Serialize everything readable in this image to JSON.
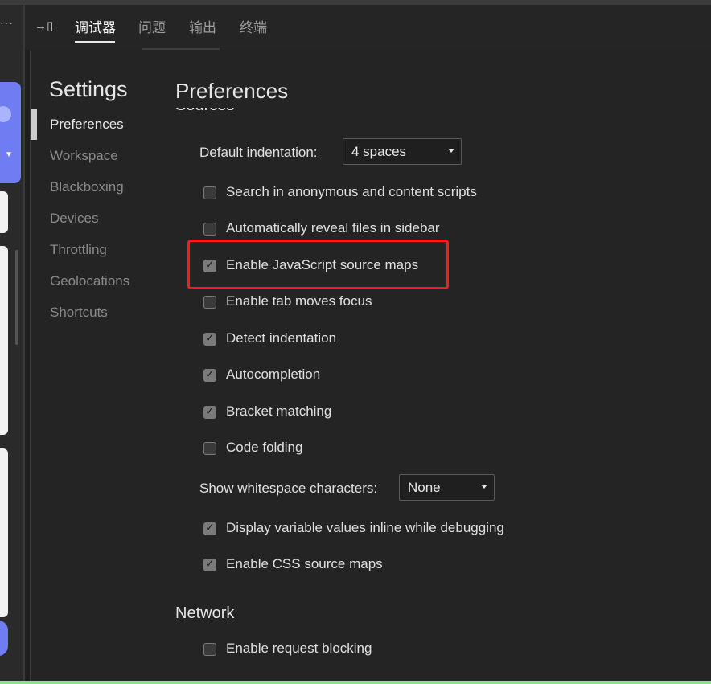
{
  "tabbar": {
    "dock_icon": "→▯",
    "tabs": [
      {
        "label": "调试器",
        "active": true
      },
      {
        "label": "问题",
        "active": false
      },
      {
        "label": "输出",
        "active": false
      },
      {
        "label": "终端",
        "active": false
      }
    ]
  },
  "settings": {
    "title": "Settings",
    "nav": [
      {
        "label": "Preferences",
        "active": true
      },
      {
        "label": "Workspace"
      },
      {
        "label": "Blackboxing"
      },
      {
        "label": "Devices"
      },
      {
        "label": "Throttling"
      },
      {
        "label": "Geolocations"
      },
      {
        "label": "Shortcuts"
      }
    ]
  },
  "preferences": {
    "title": "Preferences",
    "sources_heading": "Sources",
    "default_indentation_label": "Default indentation:",
    "default_indentation_value": "4 spaces",
    "checkboxes_top": [
      {
        "label": "Search in anonymous and content scripts",
        "checked": false
      },
      {
        "label": "Automatically reveal files in sidebar",
        "checked": false
      },
      {
        "label": "Enable JavaScript source maps",
        "checked": true
      },
      {
        "label": "Enable tab moves focus",
        "checked": false
      },
      {
        "label": "Detect indentation",
        "checked": true
      },
      {
        "label": "Autocompletion",
        "checked": true
      },
      {
        "label": "Bracket matching",
        "checked": true
      },
      {
        "label": "Code folding",
        "checked": false
      }
    ],
    "whitespace_label": "Show whitespace characters:",
    "whitespace_value": "None",
    "checkboxes_bottom": [
      {
        "label": "Display variable values inline while debugging",
        "checked": true
      },
      {
        "label": "Enable CSS source maps",
        "checked": true
      }
    ],
    "network_heading": "Network",
    "network_checkboxes": [
      {
        "label": "Enable request blocking",
        "checked": false
      }
    ]
  },
  "colors": {
    "highlight_border": "#ff1a1a",
    "panel_bg": "#242424"
  }
}
